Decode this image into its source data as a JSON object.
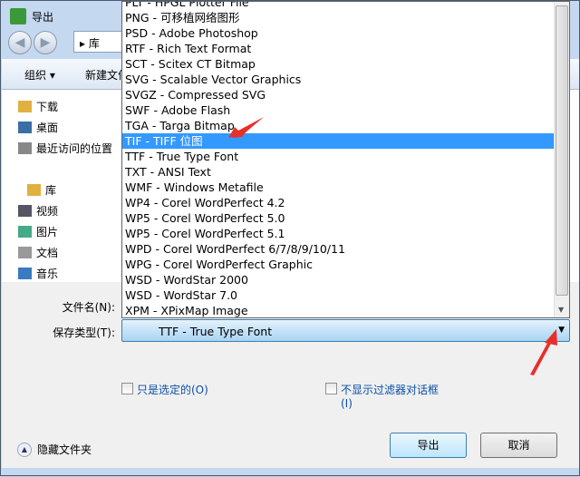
{
  "window": {
    "title": "导出"
  },
  "address": {
    "crumb": "库"
  },
  "toolbar": {
    "organize": "组织 ▾",
    "new_folder": "新建文件夹"
  },
  "sidebar": {
    "items": [
      {
        "label": "下载",
        "icon": "download-folder-icon"
      },
      {
        "label": "桌面",
        "icon": "desktop-icon"
      },
      {
        "label": "最近访问的位置",
        "icon": "recent-places-icon"
      },
      {
        "label": "库",
        "icon": "library-icon"
      },
      {
        "label": "视频",
        "icon": "video-icon"
      },
      {
        "label": "图片",
        "icon": "pictures-icon"
      },
      {
        "label": "文档",
        "icon": "documents-icon",
        "selected": true
      },
      {
        "label": "音乐",
        "icon": "music-icon"
      }
    ]
  },
  "filetype_list": {
    "items": [
      "PLT - HPGL Plotter File",
      "PNG - 可移植网络图形",
      "PSD - Adobe Photoshop",
      "RTF - Rich Text Format",
      "SCT - Scitex CT Bitmap",
      "SVG - Scalable Vector Graphics",
      "SVGZ - Compressed SVG",
      "SWF - Adobe Flash",
      "TGA - Targa Bitmap",
      "TIF - TIFF 位图",
      "TTF - True Type Font",
      "TXT - ANSI Text",
      "WMF - Windows Metafile",
      "WP4 - Corel WordPerfect 4.2",
      "WP5 - Corel WordPerfect 5.0",
      "WP5 - Corel WordPerfect 5.1",
      "WPD - Corel WordPerfect 6/7/8/9/10/11",
      "WPG - Corel WordPerfect Graphic",
      "WSD - WordStar 2000",
      "WSD - WordStar 7.0",
      "XPM - XPixMap Image"
    ],
    "highlighted": "TIF - TIFF 位图"
  },
  "form": {
    "filename_label": "文件名(N):",
    "savetype_label": "保存类型(T):",
    "savetype_value": "TTF - True Type Font"
  },
  "options": {
    "only_selected": "只是选定的(O)",
    "no_filter_dialog": "不显示过滤器对话框",
    "no_filter_dialog_key": "(I)"
  },
  "buttons": {
    "export": "导出",
    "cancel": "取消",
    "hide_folders": "隐藏文件夹"
  },
  "colors": {
    "highlight": "#3399ff",
    "annotation_arrow": "#e8302a"
  }
}
